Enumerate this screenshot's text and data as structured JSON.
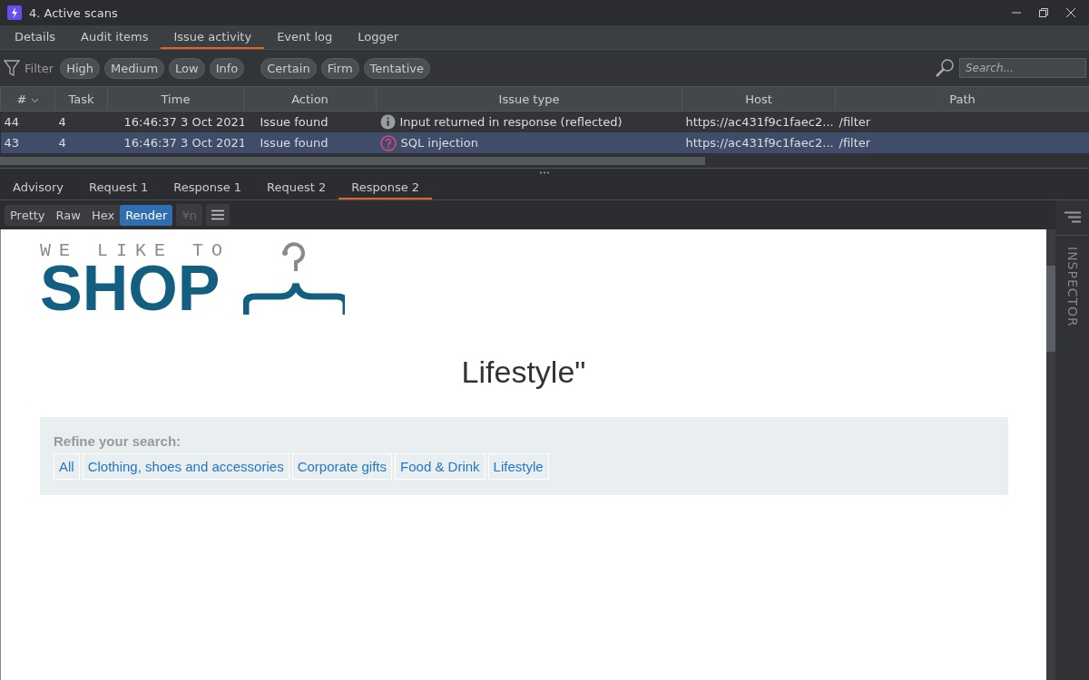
{
  "window": {
    "title": "4. Active scans"
  },
  "tabs": [
    {
      "label": "Details",
      "selected": false
    },
    {
      "label": "Audit items",
      "selected": false
    },
    {
      "label": "Issue activity",
      "selected": true
    },
    {
      "label": "Event log",
      "selected": false
    },
    {
      "label": "Logger",
      "selected": false
    }
  ],
  "filter": {
    "label": "Filter",
    "severity": [
      "High",
      "Medium",
      "Low",
      "Info"
    ],
    "confidence": [
      "Certain",
      "Firm",
      "Tentative"
    ],
    "search": {
      "placeholder": "Search..."
    }
  },
  "table": {
    "columns": [
      "#",
      "Task",
      "Time",
      "Action",
      "Issue type",
      "Host",
      "Path"
    ],
    "rows": [
      {
        "cells": [
          "44",
          "4",
          "16:46:37 3 Oct 2021",
          "Issue found",
          "Input returned in response (reflected)",
          "https://ac431f9c1faec2...",
          "/filter"
        ],
        "kind": "info",
        "selected": false
      },
      {
        "cells": [
          "43",
          "4",
          "16:46:37 3 Oct 2021",
          "Issue found",
          "SQL injection",
          "https://ac431f9c1faec2...",
          "/filter"
        ],
        "kind": "question",
        "selected": true
      }
    ]
  },
  "detail_tabs": [
    {
      "label": "Advisory",
      "selected": false
    },
    {
      "label": "Request 1",
      "selected": false
    },
    {
      "label": "Response 1",
      "selected": false
    },
    {
      "label": "Request 2",
      "selected": false
    },
    {
      "label": "Response 2",
      "selected": true
    }
  ],
  "view_modes": [
    {
      "label": "Pretty",
      "selected": false
    },
    {
      "label": "Raw",
      "selected": false
    },
    {
      "label": "Hex",
      "selected": false
    },
    {
      "label": "Render",
      "selected": true
    }
  ],
  "newline_toggle": {
    "label": "¥n",
    "disabled": true
  },
  "inspector": {
    "label": "INSPECTOR"
  },
  "page": {
    "logo_top": "WE LIKE TO",
    "logo_main": "SHOP",
    "heading": "Lifestyle\"",
    "refine_label": "Refine your search:",
    "categories": [
      "All",
      "Clothing, shoes and accessories",
      "Corporate gifts",
      "Food & Drink",
      "Lifestyle"
    ]
  }
}
